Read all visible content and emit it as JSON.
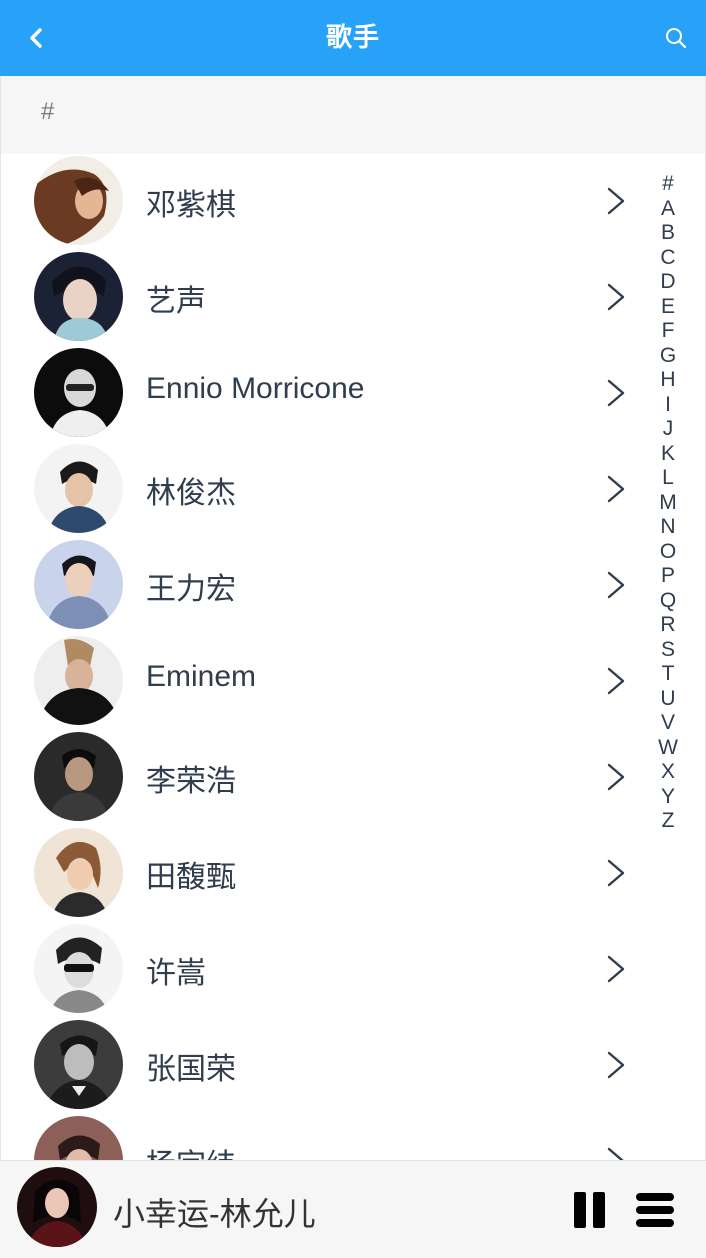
{
  "header": {
    "title": "歌手",
    "back_icon": "chevron-left-icon",
    "search_icon": "search-icon",
    "color": "#27a2f8"
  },
  "section": {
    "label": "#"
  },
  "singers": [
    {
      "name": "邓紫棋"
    },
    {
      "name": "艺声"
    },
    {
      "name": "Ennio Morricone"
    },
    {
      "name": "林俊杰"
    },
    {
      "name": "王力宏"
    },
    {
      "name": "Eminem"
    },
    {
      "name": "李荣浩"
    },
    {
      "name": "田馥甄"
    },
    {
      "name": "许嵩"
    },
    {
      "name": "张国荣"
    },
    {
      "name": "杨宗纬"
    }
  ],
  "index": [
    "#",
    "A",
    "B",
    "C",
    "D",
    "E",
    "F",
    "G",
    "H",
    "I",
    "J",
    "K",
    "L",
    "M",
    "N",
    "O",
    "P",
    "Q",
    "R",
    "S",
    "T",
    "U",
    "V",
    "W",
    "X",
    "Y",
    "Z"
  ],
  "player": {
    "song": "小幸运-林允儿",
    "pause_icon": "pause-icon",
    "playlist_icon": "playlist-icon"
  }
}
